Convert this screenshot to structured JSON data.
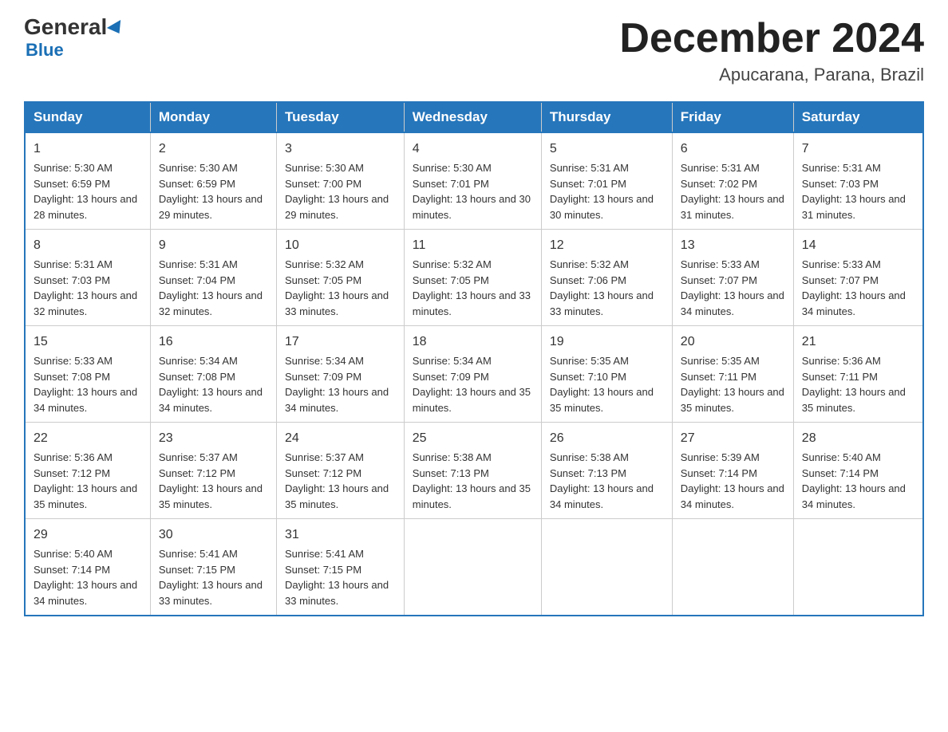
{
  "header": {
    "logo_general": "General",
    "logo_blue": "Blue",
    "month_title": "December 2024",
    "location": "Apucarana, Parana, Brazil"
  },
  "days_of_week": [
    "Sunday",
    "Monday",
    "Tuesday",
    "Wednesday",
    "Thursday",
    "Friday",
    "Saturday"
  ],
  "weeks": [
    [
      {
        "day": "1",
        "sunrise": "5:30 AM",
        "sunset": "6:59 PM",
        "daylight": "13 hours and 28 minutes."
      },
      {
        "day": "2",
        "sunrise": "5:30 AM",
        "sunset": "6:59 PM",
        "daylight": "13 hours and 29 minutes."
      },
      {
        "day": "3",
        "sunrise": "5:30 AM",
        "sunset": "7:00 PM",
        "daylight": "13 hours and 29 minutes."
      },
      {
        "day": "4",
        "sunrise": "5:30 AM",
        "sunset": "7:01 PM",
        "daylight": "13 hours and 30 minutes."
      },
      {
        "day": "5",
        "sunrise": "5:31 AM",
        "sunset": "7:01 PM",
        "daylight": "13 hours and 30 minutes."
      },
      {
        "day": "6",
        "sunrise": "5:31 AM",
        "sunset": "7:02 PM",
        "daylight": "13 hours and 31 minutes."
      },
      {
        "day": "7",
        "sunrise": "5:31 AM",
        "sunset": "7:03 PM",
        "daylight": "13 hours and 31 minutes."
      }
    ],
    [
      {
        "day": "8",
        "sunrise": "5:31 AM",
        "sunset": "7:03 PM",
        "daylight": "13 hours and 32 minutes."
      },
      {
        "day": "9",
        "sunrise": "5:31 AM",
        "sunset": "7:04 PM",
        "daylight": "13 hours and 32 minutes."
      },
      {
        "day": "10",
        "sunrise": "5:32 AM",
        "sunset": "7:05 PM",
        "daylight": "13 hours and 33 minutes."
      },
      {
        "day": "11",
        "sunrise": "5:32 AM",
        "sunset": "7:05 PM",
        "daylight": "13 hours and 33 minutes."
      },
      {
        "day": "12",
        "sunrise": "5:32 AM",
        "sunset": "7:06 PM",
        "daylight": "13 hours and 33 minutes."
      },
      {
        "day": "13",
        "sunrise": "5:33 AM",
        "sunset": "7:07 PM",
        "daylight": "13 hours and 34 minutes."
      },
      {
        "day": "14",
        "sunrise": "5:33 AM",
        "sunset": "7:07 PM",
        "daylight": "13 hours and 34 minutes."
      }
    ],
    [
      {
        "day": "15",
        "sunrise": "5:33 AM",
        "sunset": "7:08 PM",
        "daylight": "13 hours and 34 minutes."
      },
      {
        "day": "16",
        "sunrise": "5:34 AM",
        "sunset": "7:08 PM",
        "daylight": "13 hours and 34 minutes."
      },
      {
        "day": "17",
        "sunrise": "5:34 AM",
        "sunset": "7:09 PM",
        "daylight": "13 hours and 34 minutes."
      },
      {
        "day": "18",
        "sunrise": "5:34 AM",
        "sunset": "7:09 PM",
        "daylight": "13 hours and 35 minutes."
      },
      {
        "day": "19",
        "sunrise": "5:35 AM",
        "sunset": "7:10 PM",
        "daylight": "13 hours and 35 minutes."
      },
      {
        "day": "20",
        "sunrise": "5:35 AM",
        "sunset": "7:11 PM",
        "daylight": "13 hours and 35 minutes."
      },
      {
        "day": "21",
        "sunrise": "5:36 AM",
        "sunset": "7:11 PM",
        "daylight": "13 hours and 35 minutes."
      }
    ],
    [
      {
        "day": "22",
        "sunrise": "5:36 AM",
        "sunset": "7:12 PM",
        "daylight": "13 hours and 35 minutes."
      },
      {
        "day": "23",
        "sunrise": "5:37 AM",
        "sunset": "7:12 PM",
        "daylight": "13 hours and 35 minutes."
      },
      {
        "day": "24",
        "sunrise": "5:37 AM",
        "sunset": "7:12 PM",
        "daylight": "13 hours and 35 minutes."
      },
      {
        "day": "25",
        "sunrise": "5:38 AM",
        "sunset": "7:13 PM",
        "daylight": "13 hours and 35 minutes."
      },
      {
        "day": "26",
        "sunrise": "5:38 AM",
        "sunset": "7:13 PM",
        "daylight": "13 hours and 34 minutes."
      },
      {
        "day": "27",
        "sunrise": "5:39 AM",
        "sunset": "7:14 PM",
        "daylight": "13 hours and 34 minutes."
      },
      {
        "day": "28",
        "sunrise": "5:40 AM",
        "sunset": "7:14 PM",
        "daylight": "13 hours and 34 minutes."
      }
    ],
    [
      {
        "day": "29",
        "sunrise": "5:40 AM",
        "sunset": "7:14 PM",
        "daylight": "13 hours and 34 minutes."
      },
      {
        "day": "30",
        "sunrise": "5:41 AM",
        "sunset": "7:15 PM",
        "daylight": "13 hours and 33 minutes."
      },
      {
        "day": "31",
        "sunrise": "5:41 AM",
        "sunset": "7:15 PM",
        "daylight": "13 hours and 33 minutes."
      },
      null,
      null,
      null,
      null
    ]
  ],
  "labels": {
    "sunrise": "Sunrise:",
    "sunset": "Sunset:",
    "daylight": "Daylight:"
  }
}
